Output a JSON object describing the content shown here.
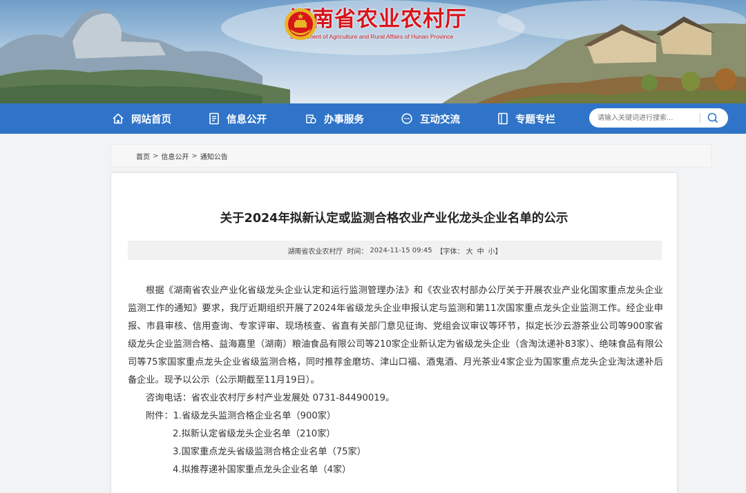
{
  "header": {
    "site_name": "湖南省农业农村厅",
    "site_name_en": "Department of Agriculture and Rural Affairs of Hunan Province",
    "emblem_icon": "national-emblem-icon"
  },
  "nav": {
    "items": [
      {
        "label": "网站首页",
        "icon": "home-icon"
      },
      {
        "label": "信息公开",
        "icon": "document-list-icon"
      },
      {
        "label": "办事服务",
        "icon": "service-icon"
      },
      {
        "label": "互动交流",
        "icon": "chat-icon"
      },
      {
        "label": "专题专栏",
        "icon": "column-icon"
      }
    ],
    "search_placeholder": "请输入关键词进行搜索...",
    "search_icon": "search-icon",
    "color": "#2f74c8"
  },
  "breadcrumb": {
    "items": [
      "首页",
      "信息公开",
      "通知公告"
    ],
    "separator": ">"
  },
  "article": {
    "title": "关于2024年拟新认定或监测合格农业产业化龙头企业名单的公示",
    "meta": {
      "source": "湖南省农业农村厅",
      "time_label": "时间：",
      "time": "2024-11-15 09:45",
      "font_label": "【字体：",
      "font_large": "大",
      "font_medium": "中",
      "font_small": "小",
      "font_close": "】"
    },
    "paragraph": "根据《湖南省农业产业化省级龙头企业认定和运行监测管理办法》和《农业农村部办公厅关于开展农业产业化国家重点龙头企业监测工作的通知》要求，我厅近期组织开展了2024年省级龙头企业申报认定与监测和第11次国家重点龙头企业监测工作。经企业申报、市县审核、信用查询、专家评审、现场核查、省直有关部门意见征询、党组会议审议等环节，拟定长沙云游茶业公司等900家省级龙头企业监测合格、益海嘉里（湖南）粮油食品有限公司等210家企业新认定为省级龙头企业（含淘汰递补83家）、绝味食品有限公司等75家国家重点龙头企业省级监测合格，同时推荐金磨坊、津山口福、酒鬼酒、月光茶业4家企业为国家重点龙头企业淘汰递补后备企业。现予以公示（公示期截至11月19日）。",
    "contact": "咨询电话：省农业农村厅乡村产业发展处 0731-84490019。",
    "attachments_label": "附件：",
    "attachments": [
      "1.省级龙头监测合格企业名单（900家）",
      "2.拟新认定省级龙头企业名单（210家）",
      "3.国家重点龙头省级监测合格企业名单（75家）",
      "4.拟推荐递补国家重点龙头企业名单（4家）"
    ]
  },
  "colors": {
    "title_red": "#d8151b",
    "nav_blue": "#2f74c8",
    "page_bg": "#f2f3f5"
  }
}
